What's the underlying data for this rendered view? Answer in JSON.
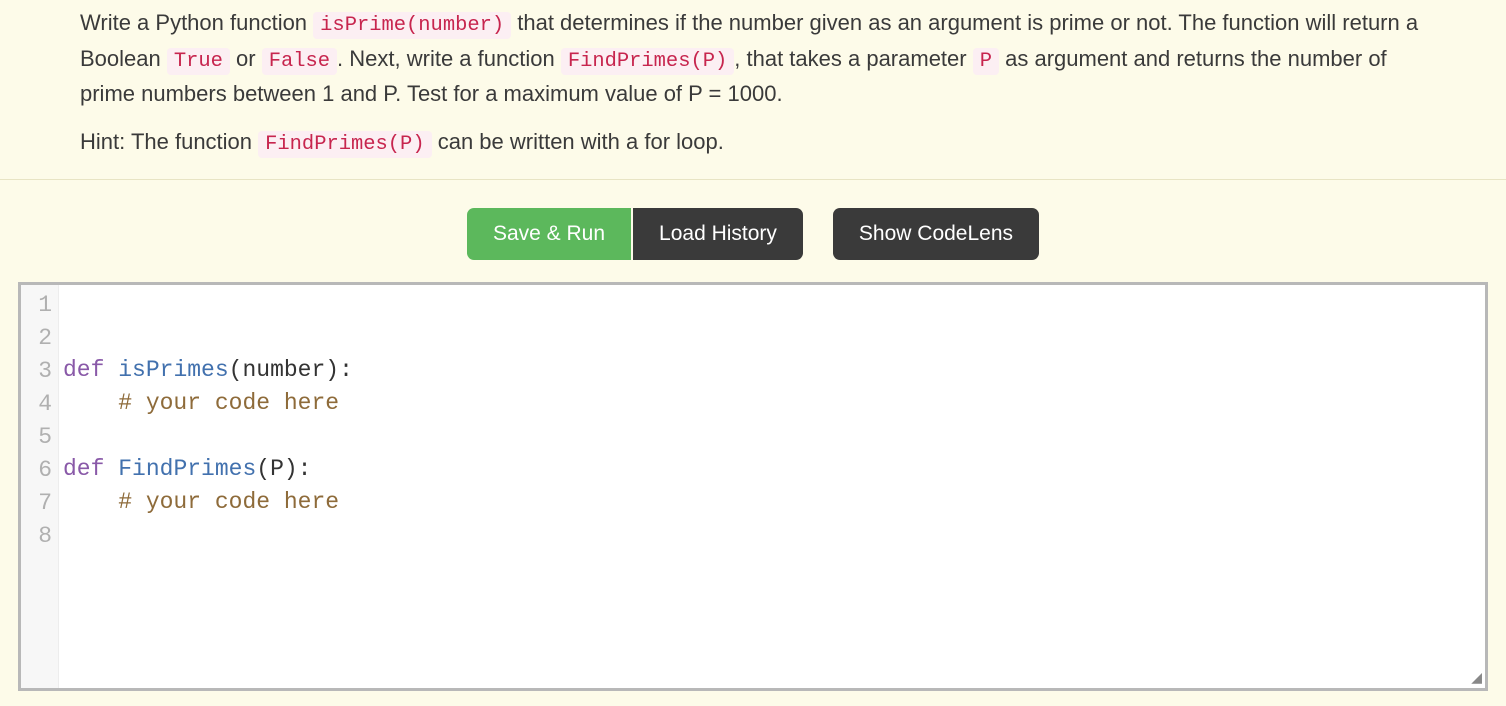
{
  "instructions": {
    "para1": {
      "t1": "Write a Python function ",
      "c1": "isPrime(number)",
      "t2": " that determines if the number given as an argument is prime or not. The function will return a Boolean ",
      "c2": "True",
      "t3": " or ",
      "c3": "False",
      "t4": ". Next, write a function ",
      "c4": "FindPrimes(P)",
      "t5": ", that takes a parameter ",
      "c5": "P",
      "t6": " as argument and returns the number of prime numbers between 1 and P. Test for a maximum value of P = 1000."
    },
    "para2": {
      "t1": "Hint: The function ",
      "c1": "FindPrimes(P)",
      "t2": " can be written with a for loop."
    }
  },
  "toolbar": {
    "save_run": "Save & Run",
    "load_history": "Load History",
    "show_codelens": "Show CodeLens"
  },
  "editor": {
    "line_count": 8,
    "lines": [
      {
        "n": 1,
        "tokens": [
          {
            "cls": "kw",
            "t": "def"
          },
          {
            "cls": "punct",
            "t": " "
          },
          {
            "cls": "fn",
            "t": "isPrimes"
          },
          {
            "cls": "punct",
            "t": "(number):"
          }
        ]
      },
      {
        "n": 2,
        "tokens": [
          {
            "cls": "punct",
            "t": "    "
          },
          {
            "cls": "comment",
            "t": "# your code here"
          }
        ]
      },
      {
        "n": 3,
        "tokens": []
      },
      {
        "n": 4,
        "tokens": [
          {
            "cls": "kw",
            "t": "def"
          },
          {
            "cls": "punct",
            "t": " "
          },
          {
            "cls": "fn",
            "t": "FindPrimes"
          },
          {
            "cls": "punct",
            "t": "(P):"
          }
        ]
      },
      {
        "n": 5,
        "tokens": [
          {
            "cls": "punct",
            "t": "    "
          },
          {
            "cls": "comment",
            "t": "# your code here"
          }
        ]
      },
      {
        "n": 6,
        "tokens": []
      },
      {
        "n": 7,
        "tokens": []
      },
      {
        "n": 8,
        "tokens": []
      }
    ]
  }
}
